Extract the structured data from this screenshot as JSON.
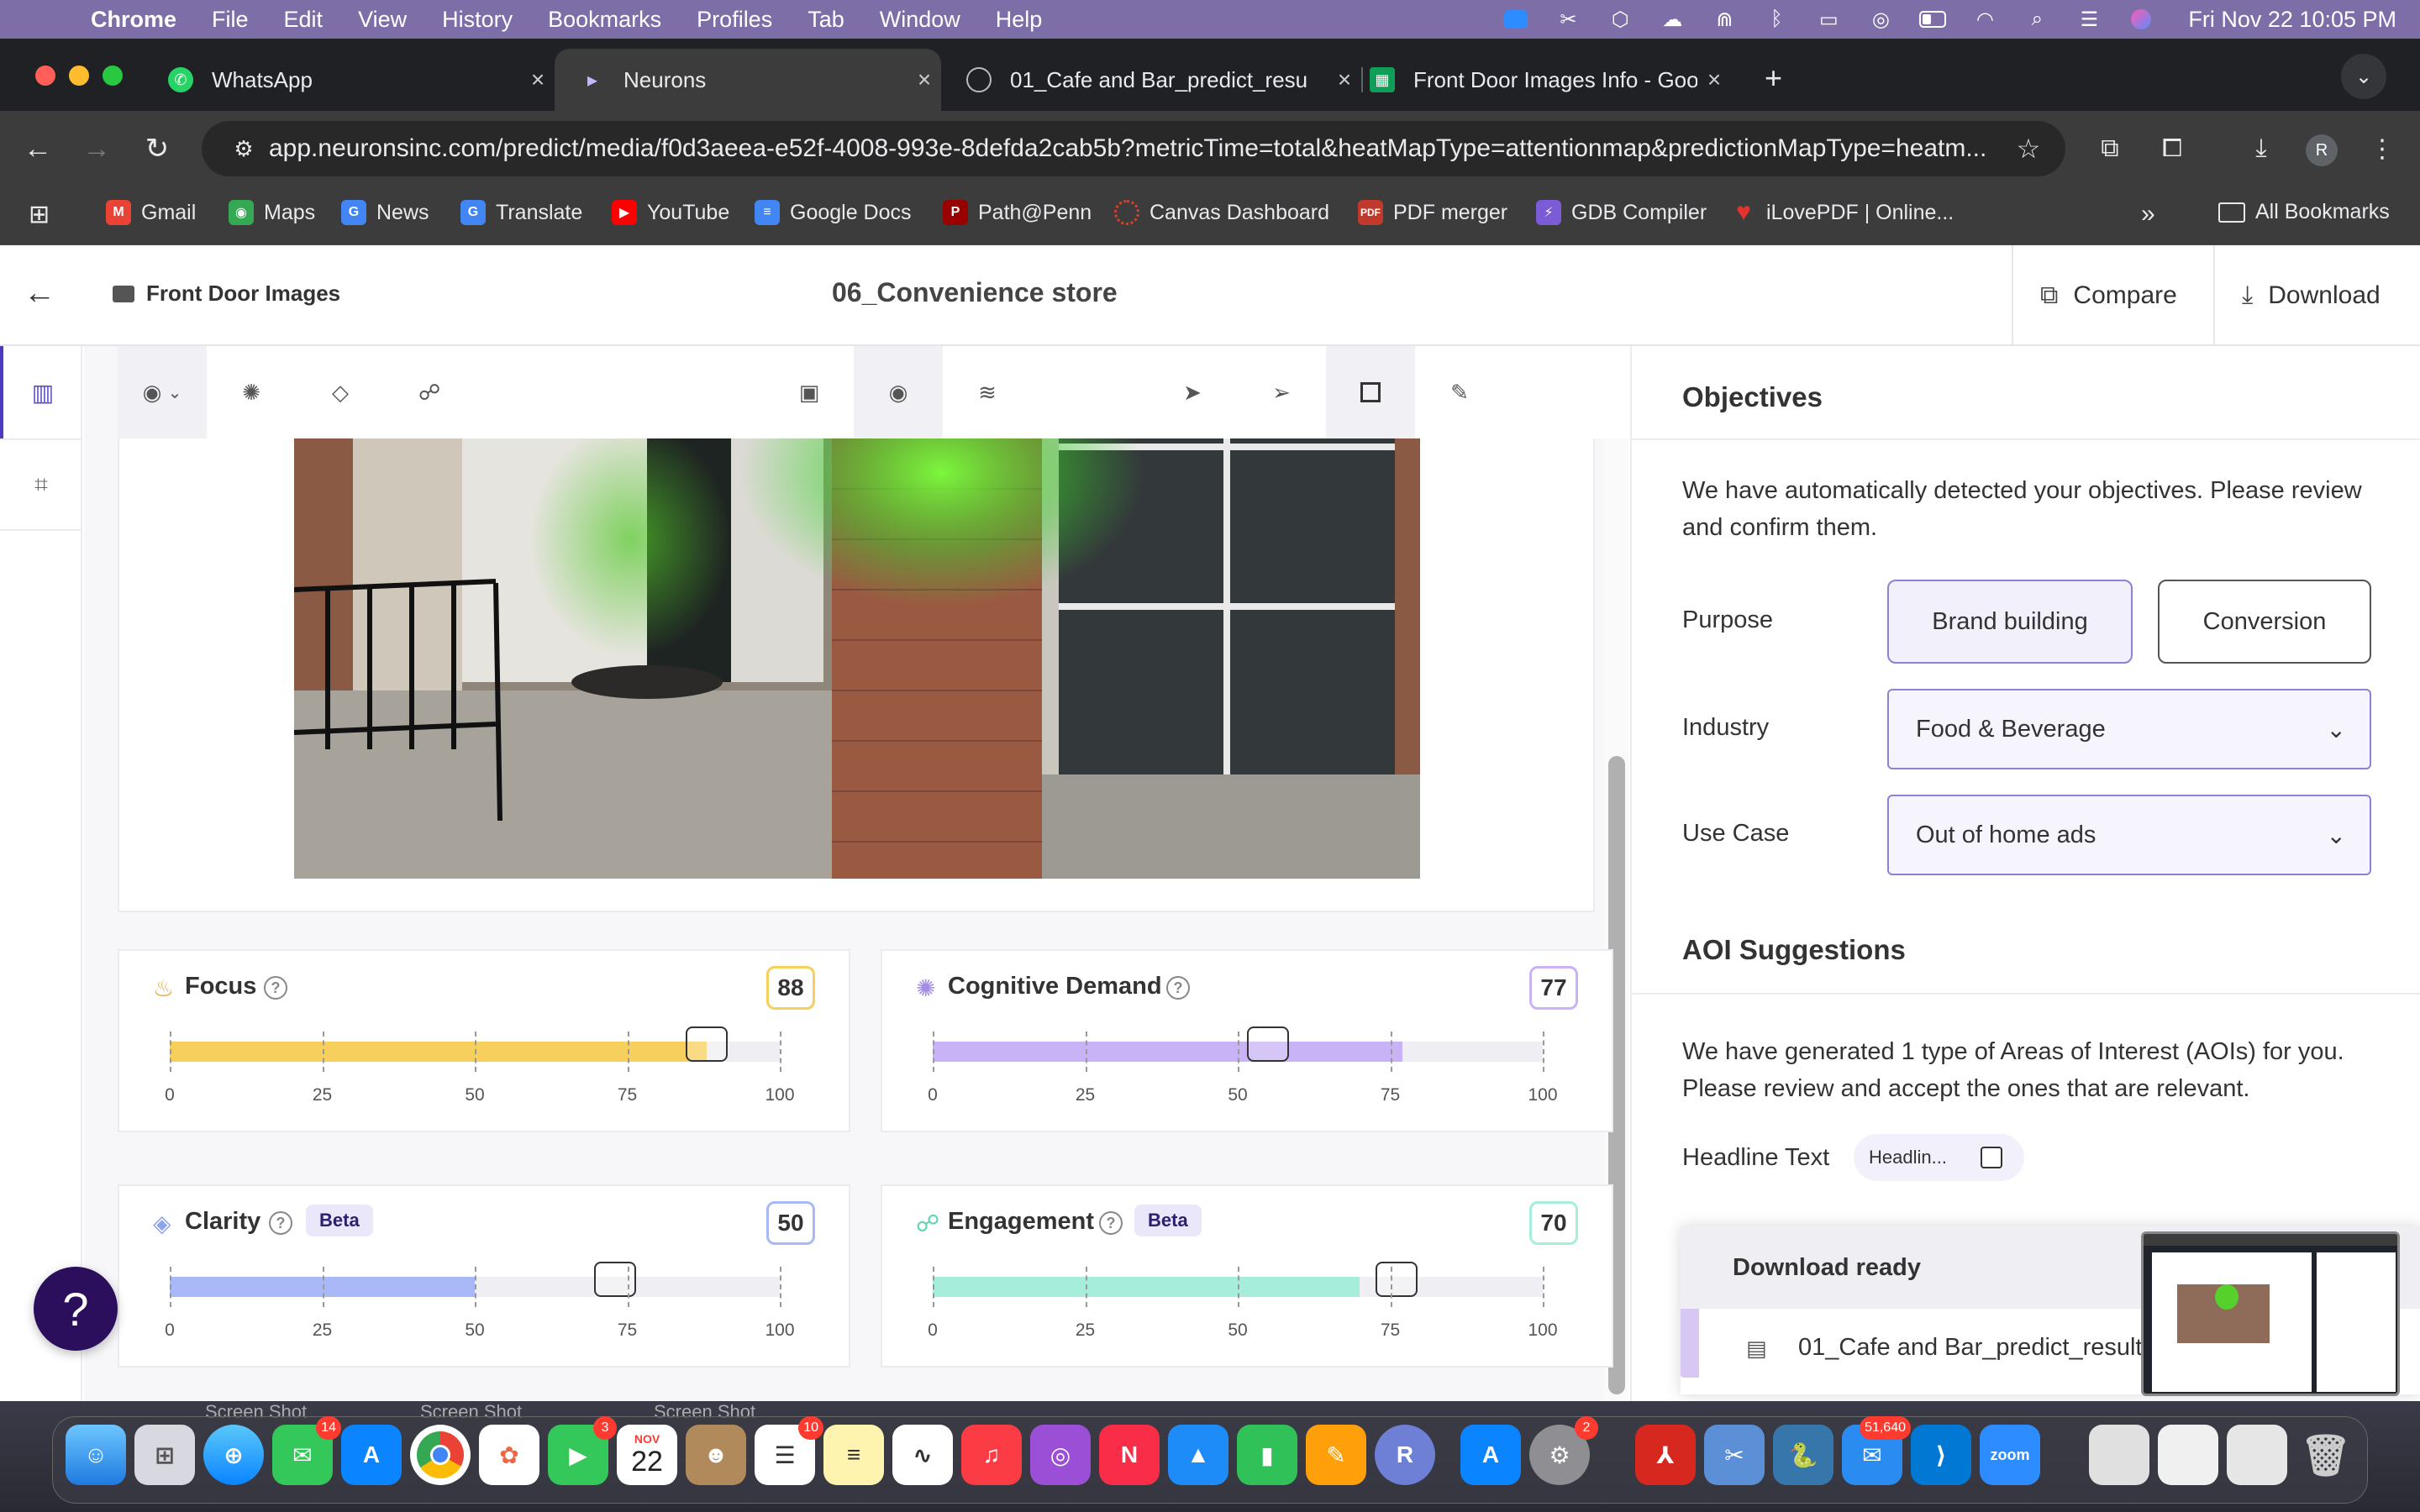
{
  "menubar": {
    "app": "Chrome",
    "items": [
      "File",
      "Edit",
      "View",
      "History",
      "Bookmarks",
      "Profiles",
      "Tab",
      "Window",
      "Help"
    ],
    "clock": "Fri Nov 22  10:05 PM"
  },
  "tabs": [
    {
      "title": "WhatsApp",
      "icon": "whatsapp-icon",
      "color": "#25d366"
    },
    {
      "title": "Neurons",
      "icon": "neurons-icon",
      "color": "#c2b7ff"
    },
    {
      "title": "01_Cafe and Bar_predict_resu",
      "icon": "globe-icon",
      "color": "#777777"
    },
    {
      "title": "Front Door Images Info - Goo",
      "icon": "sheets-icon",
      "color": "#0f9d58"
    }
  ],
  "address": {
    "url": "app.neuronsinc.com/predict/media/f0d3aeea-e52f-4008-993e-8defda2cab5b?metricTime=total&heatMapType=attentionmap&predictionMapType=heatm..."
  },
  "bookmarks": [
    {
      "label": "Gmail",
      "color": "#ea4335",
      "glyph": "M"
    },
    {
      "label": "Maps",
      "color": "#34a853",
      "glyph": "◉"
    },
    {
      "label": "News",
      "color": "#4285f4",
      "glyph": "G"
    },
    {
      "label": "Translate",
      "color": "#4285f4",
      "glyph": "G"
    },
    {
      "label": "YouTube",
      "color": "#ff0000",
      "glyph": "▶"
    },
    {
      "label": "Google Docs",
      "color": "#4285f4",
      "glyph": "≡"
    },
    {
      "label": "Path@Penn",
      "color": "#990000",
      "glyph": "P"
    },
    {
      "label": "Canvas Dashboard",
      "color": "#e13f2b",
      "glyph": "◌"
    },
    {
      "label": "PDF merger",
      "color": "#c0392b",
      "glyph": "PDF"
    },
    {
      "label": "GDB Compiler",
      "color": "#7b5cd6",
      "glyph": "⚡"
    },
    {
      "label": "iLovePDF | Online...",
      "color": "#e5322d",
      "glyph": "♥"
    }
  ],
  "bookmarks_right": "All Bookmarks",
  "header": {
    "breadcrumb": "Front Door Images",
    "title": "06_Convenience store",
    "compare": "Compare",
    "download": "Download"
  },
  "metrics": [
    {
      "name": "Focus",
      "score": "88",
      "value": 88,
      "beta": "",
      "color": "#f7cf5c",
      "border": "#f7cf5c",
      "icon": "flame-icon",
      "handle_value": 88
    },
    {
      "name": "Cognitive Demand",
      "score": "77",
      "value": 77,
      "beta": "",
      "color": "#c7b3f5",
      "border": "#c7b3f5",
      "icon": "brain-icon",
      "handle_value": 55
    },
    {
      "name": "Clarity",
      "score": "50",
      "value": 50,
      "beta": "Beta",
      "color": "#a9b8f6",
      "border": "#a9b8f6",
      "icon": "diamond-icon",
      "handle_value": 73
    },
    {
      "name": "Engagement",
      "score": "70",
      "value": 70,
      "beta": "Beta",
      "color": "#a6eedb",
      "border": "#a6eedb",
      "icon": "nodes-icon",
      "handle_value": 76
    }
  ],
  "axis_ticks": [
    "0",
    "25",
    "50",
    "75",
    "100"
  ],
  "objectives": {
    "title": "Objectives",
    "description": "We have automatically detected your objectives. Please review and confirm them.",
    "purpose_label": "Purpose",
    "purpose_options": [
      "Brand building",
      "Conversion"
    ],
    "purpose_selected": "Brand building",
    "industry_label": "Industry",
    "industry_value": "Food & Beverage",
    "usecase_label": "Use Case",
    "usecase_value": "Out of home ads"
  },
  "aoi": {
    "title": "AOI Suggestions",
    "description": "We have generated 1 type of Areas of Interest (AOIs) for you. Please review and accept the ones that are relevant.",
    "type_label": "Headline Text",
    "chip_label": "Headlin..."
  },
  "download_toast": {
    "title": "Download ready",
    "file": "01_Cafe and Bar_predict_result"
  },
  "help_button": "?",
  "desktop_labels": [
    "Screen Shot",
    "Screen Shot",
    "Screen Shot"
  ],
  "dock": {
    "calendar_month": "NOV",
    "calendar_day": "22",
    "badges": {
      "messages": "14",
      "facetime": "3",
      "reminders": "10",
      "settings": "2",
      "mail": "51,640"
    }
  }
}
